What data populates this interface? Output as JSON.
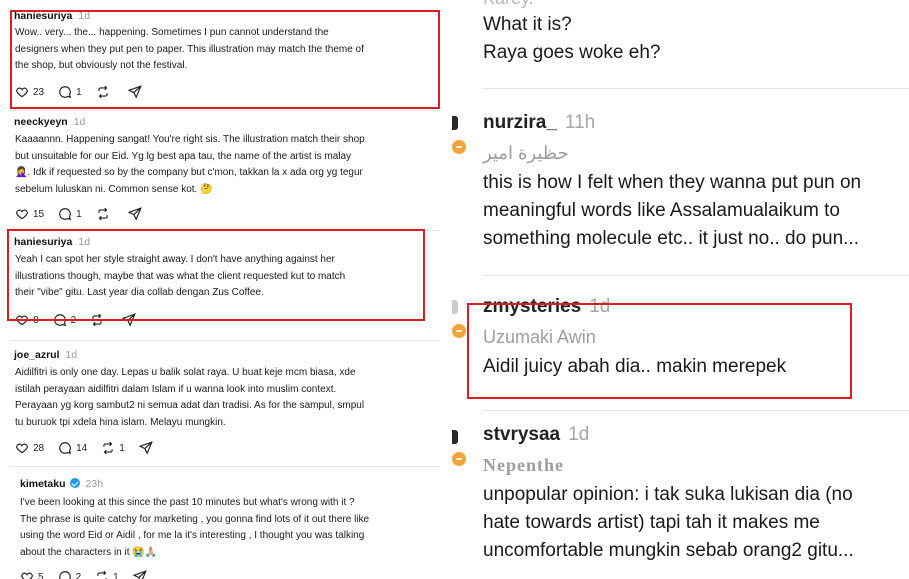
{
  "left": {
    "posts": [
      {
        "user": "haniesuriya",
        "time": "1d",
        "lines": [
          "Wow.. very... the... happening. Sometimes I pun cannot understand the",
          "designers when they put pen to paper. This illustration may match the theme of",
          "the shop, but obviously not the festival."
        ],
        "likes": "23",
        "replies": "1",
        "reposts": ""
      },
      {
        "user": "neeckyeyn",
        "time": "1d",
        "lines": [
          "Kaaaannn. Happening sangat! You're right sis. The illustration match their shop",
          "but unsuitable for our Eid. Yg lg best apa tau, the name of the artist is malay",
          "🤦‍♀️. Idk if requested so by the company but c'mon, takkan la x ada org yg tegur",
          "sebelum luluskan ni. Common sense kot. 🤔"
        ],
        "likes": "15",
        "replies": "1",
        "reposts": ""
      },
      {
        "user": "haniesuriya",
        "time": "1d",
        "lines": [
          "Yeah I can spot her style straight away. I don't have anything against her",
          "illustrations though, maybe that was what the client requested kut to match",
          "their \"vibe\" gitu. Last year dia collab dengan Zus Coffee."
        ],
        "likes": "8",
        "replies": "2",
        "reposts": ""
      },
      {
        "user": "joe_azrul",
        "time": "1d",
        "lines": [
          "Aidilfitri is only one day. Lepas u balik solat raya. U buat keje mcm biasa, xde",
          "istilah perayaan aidilfitri dalam Islam if u wanna look into muslim context.",
          "Perayaan yg korg sambut2 ni semua adat dan tradisi. As for the sampul, smpul",
          "tu buruok tpi xdela hina islam. Melayu mungkin."
        ],
        "likes": "28",
        "replies": "14",
        "reposts": "1"
      },
      {
        "user": "kimetaku",
        "time": "23h",
        "lines": [
          "I've been looking at this since the past 10 minutes but what's wrong with it ?",
          "The phrase is quite catchy for marketing , you gonna find lots of it out there like",
          "using the word Eid or Aidil , for me la it's interesting , I thought you was talking",
          "about the characters in it 😭🙏🏼"
        ],
        "likes": "5",
        "replies": "2",
        "reposts": "1"
      }
    ]
  },
  "right": {
    "top_user_partial": "Karey.",
    "top_lines": [
      "What it is?",
      "Raya goes woke eh?"
    ],
    "comments": [
      {
        "user": "nurzira_",
        "time": "11h",
        "sub": "حظيرة امير",
        "lines": [
          "this is how I felt when they wanna put pun on",
          "meaningful words like Assalamualaikum to",
          "something molecule etc.. it just no.. do pun..."
        ]
      },
      {
        "user": "zmysteries",
        "time": "1d",
        "sub": "Uzumaki Awin",
        "lines": [
          "Aidil juicy abah dia.. makin merepek"
        ]
      },
      {
        "user": "stvrysaa",
        "time": "1d",
        "sub": "Nepenthe",
        "lines": [
          "unpopular opinion: i tak suka lukisan dia (no",
          "hate towards artist) tapi tah it makes me",
          "uncomfortable mungkin sebab orang2 gitu..."
        ]
      }
    ]
  },
  "colors": {
    "highlight": "#d81f26",
    "timestamp": "#9a9a9a",
    "verified": "#1d9bf0"
  },
  "icons": [
    "heart-icon",
    "comment-icon",
    "repost-icon",
    "share-icon",
    "verified-icon"
  ]
}
